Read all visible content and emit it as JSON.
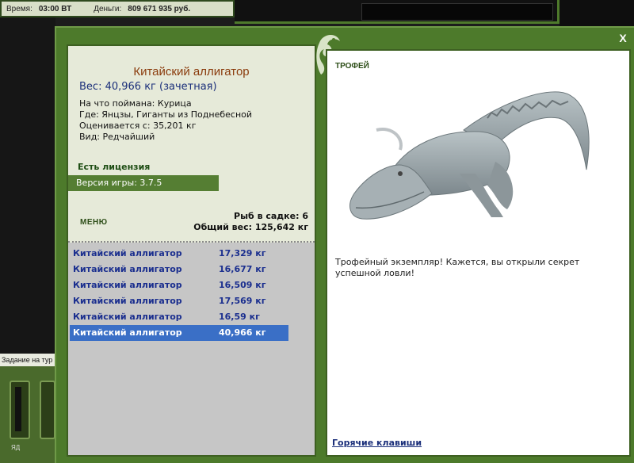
{
  "status_bar": {
    "time_label": "Время:",
    "time_value": "03:00 ВТ",
    "money_label": "Деньги:",
    "money_value": "809 671 935 руб."
  },
  "side": {
    "task_label": "Задание на тур",
    "slot_label": "ЯД"
  },
  "fish": {
    "name": "Китайский аллигатор",
    "weight": "Вес: 40,966 кг (зачетная)",
    "caught_on": "На что поймана: Курица",
    "location": "Где: Янцзы, Гиганты из Поднебесной",
    "rated_from": "Оценивается с: 35,201 кг",
    "kind": "Вид: Редчайший"
  },
  "license": "Есть лицензия",
  "version": "Версия игры: 3.7.5",
  "menu_label": "МЕНЮ",
  "keepnet": {
    "count": "Рыб в садке: 6",
    "total": "Общий вес: 125,642 кг"
  },
  "catch_list": [
    {
      "name": "Китайский аллигатор",
      "weight": "17,329 кг"
    },
    {
      "name": "Китайский аллигатор",
      "weight": "16,677 кг"
    },
    {
      "name": "Китайский аллигатор",
      "weight": "16,509 кг"
    },
    {
      "name": "Китайский аллигатор",
      "weight": "17,569 кг"
    },
    {
      "name": "Китайский аллигатор",
      "weight": "16,59 кг"
    },
    {
      "name": "Китайский аллигатор",
      "weight": "40,966 кг"
    }
  ],
  "selected_index": 5,
  "trophy": {
    "header": "ТРОФЕЙ",
    "description": "Трофейный экземпляр! Кажется, вы открыли секрет успешной ловли!"
  },
  "hotkeys": "Горячие клавиши",
  "close": "X",
  "icons": [
    "close-icon",
    "chameleon-emblem-icon",
    "alligator-image"
  ]
}
